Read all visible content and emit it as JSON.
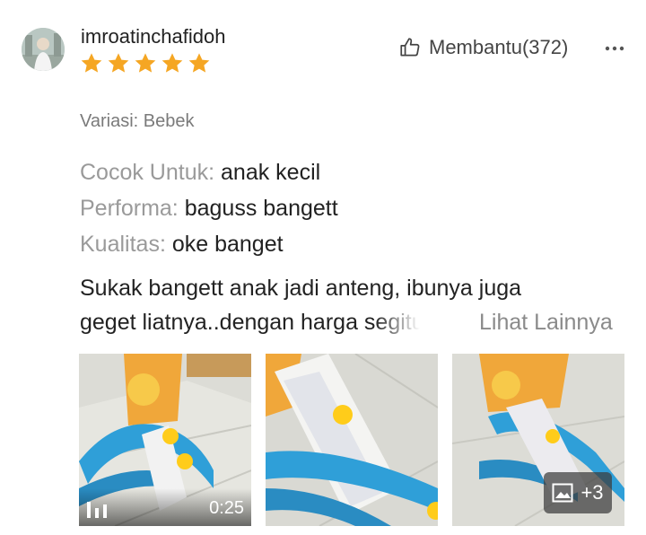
{
  "review": {
    "username": "imroatinchafidoh",
    "rating": 5,
    "helpful_label": "Membantu(372)",
    "variant": "Variasi: Bebek",
    "attributes": [
      {
        "key": "Cocok Untuk:",
        "value": "anak kecil"
      },
      {
        "key": "Performa:",
        "value": "baguss bangett"
      },
      {
        "key": "Kualitas:",
        "value": "oke banget"
      }
    ],
    "text_line1": "Sukak bangett anak jadi anteng, ibunya juga",
    "text_line2": "geget liatnya..dengan harga segitu",
    "see_more_label": "Lihat Lainnya"
  },
  "media": {
    "video_duration": "0:25",
    "extra_count": "+3"
  },
  "icons": {
    "star": "star-icon",
    "helpful": "thumbs-up-icon",
    "more": "more-icon",
    "video": "video-icon",
    "gallery": "image-icon"
  },
  "colors": {
    "star": "#f5a623",
    "muted_text": "#9a9a9a",
    "track_blue": "#2f9fd8"
  }
}
